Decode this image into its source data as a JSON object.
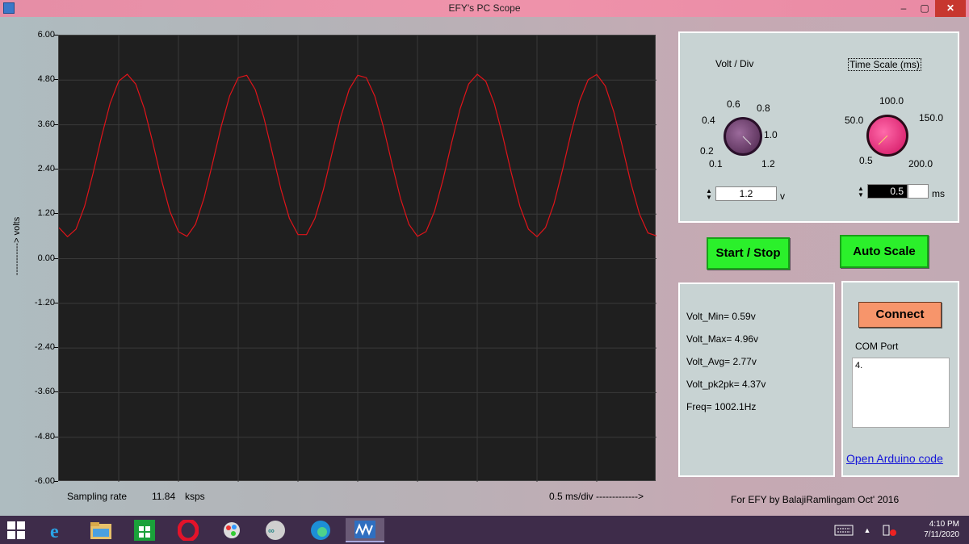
{
  "window": {
    "title": "EFY's PC Scope",
    "min_label": "–",
    "max_label": "▢",
    "close_label": "✕"
  },
  "chart_data": {
    "type": "line",
    "title": "",
    "xlabel": "0.5  ms/div ------------->",
    "ylabel": "-----------> volts",
    "ylim": [
      -6.0,
      6.0
    ],
    "yticks": [
      "6.00",
      "4.80",
      "3.60",
      "2.40",
      "1.20",
      "0.00",
      "-1.20",
      "-2.40",
      "-3.60",
      "-4.80",
      "-6.00"
    ],
    "grid": true,
    "series": [
      {
        "color": "#e0141a",
        "waveform": "sine",
        "v_min": 0.59,
        "v_max": 4.96,
        "cycles_shown": 5.1
      }
    ]
  },
  "footer": {
    "sampling_label": "Sampling rate",
    "sampling_value": "11.84",
    "sampling_unit": "ksps",
    "credit": "For EFY by BalajiRamlingam Oct' 2016"
  },
  "volt_knob": {
    "title": "Volt / Div",
    "ticks": [
      "0.1",
      "0.2",
      "0.4",
      "0.6",
      "0.8",
      "1.0",
      "1.2"
    ],
    "value": "1.2",
    "unit": "v",
    "color": "#6b3a6b"
  },
  "time_knob": {
    "title": "Time Scale (ms)",
    "ticks": [
      "0.5",
      "50.0",
      "100.0",
      "150.0",
      "200.0"
    ],
    "value": "0.5",
    "unit": "ms",
    "color": "#f0247a"
  },
  "buttons": {
    "start_stop": "Start / Stop",
    "auto_scale": "Auto Scale",
    "connect": "Connect"
  },
  "stats": {
    "v_min": "Volt_Min= 0.59v",
    "v_max": "Volt_Max= 4.96v",
    "v_avg": "Volt_Avg= 2.77v",
    "v_pk2pk": "Volt_pk2pk= 4.37v",
    "freq": "Freq= 1002.1Hz"
  },
  "com": {
    "label": "COM Port",
    "ports": [
      "4."
    ],
    "link": "Open Arduino code"
  },
  "taskbar": {
    "time": "4:10 PM",
    "date": "7/11/2020",
    "apps": [
      "windows-start-icon",
      "edge-legacy-icon",
      "file-explorer-icon",
      "store-icon",
      "opera-icon",
      "paint-icon",
      "arduino-icon",
      "edge-icon",
      "scope-app-icon"
    ]
  }
}
